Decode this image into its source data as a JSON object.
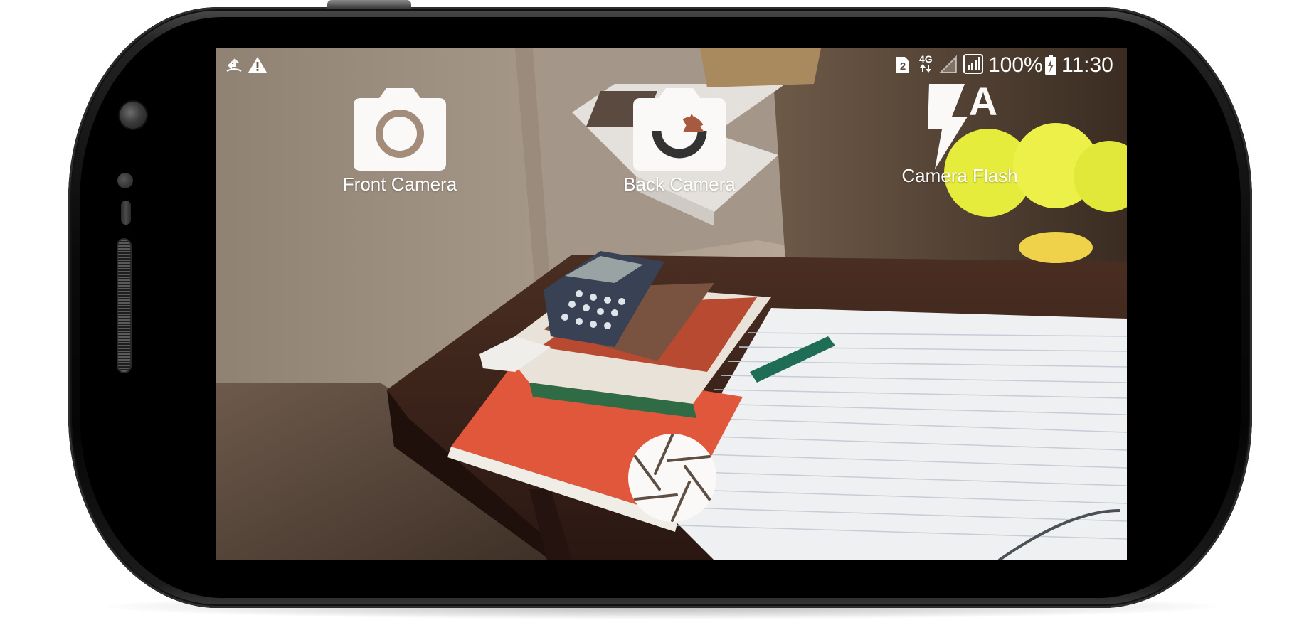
{
  "status_bar": {
    "sim_badge": "2",
    "network_type": "4G",
    "battery_percent": "100%",
    "clock": "11:30",
    "icons": [
      "data-transfer-icon",
      "warning-icon",
      "sim-2-icon",
      "network-4g-icon",
      "signal-empty-icon",
      "signal-sim2-icon",
      "battery-charging-icon"
    ]
  },
  "camera": {
    "front_camera_label": "Front Camera",
    "back_camera_label": "Back Camera",
    "flash_label": "Camera Flash",
    "flash_mode_letter": "A",
    "shutter_icon": "shutter-icon"
  },
  "colors": {
    "icon_fill": "#ffffff",
    "lens_ring": "#a38c7a",
    "back_icon_arrow": "#a85a40",
    "back_icon_curve": "#333333"
  }
}
